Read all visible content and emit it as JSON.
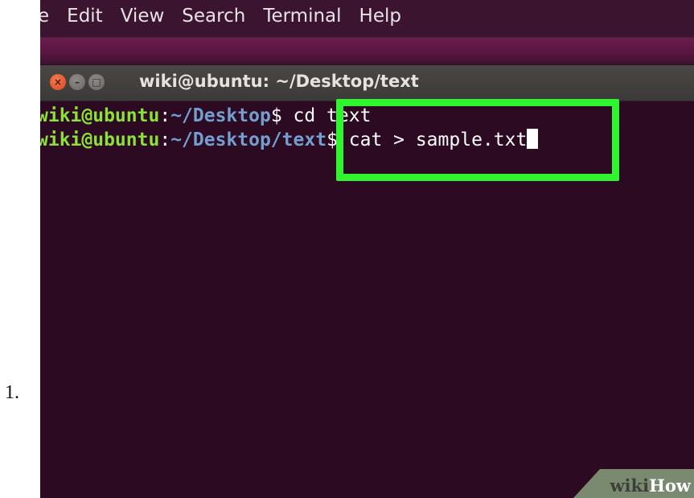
{
  "step": {
    "number": "1."
  },
  "menubar": {
    "items": [
      "e",
      "Edit",
      "View",
      "Search",
      "Terminal",
      "Help"
    ]
  },
  "window": {
    "title": "wiki@ubuntu: ~/Desktop/text",
    "buttons": {
      "close": "×",
      "minimize": "–",
      "maximize": "□"
    }
  },
  "terminal": {
    "line1": {
      "user": "wiki@ubuntu",
      "sep": ":",
      "path": "~/Desktop",
      "cmd": "$ cd text"
    },
    "line2": {
      "user": "wiki@ubuntu",
      "sep": ":",
      "path": "~/Desktop/text",
      "cmd": "$ cat > sample.txt"
    }
  },
  "watermark": {
    "wiki": "wiki",
    "how": "How"
  },
  "colors": {
    "terminal_bg": "#2c0a22",
    "prompt_user": "#8ae234",
    "prompt_path": "#729fcf",
    "highlight": "#2ef52e",
    "close_button": "#e95420"
  },
  "icons": [
    "close-icon",
    "minimize-icon",
    "maximize-icon",
    "text-cursor"
  ]
}
